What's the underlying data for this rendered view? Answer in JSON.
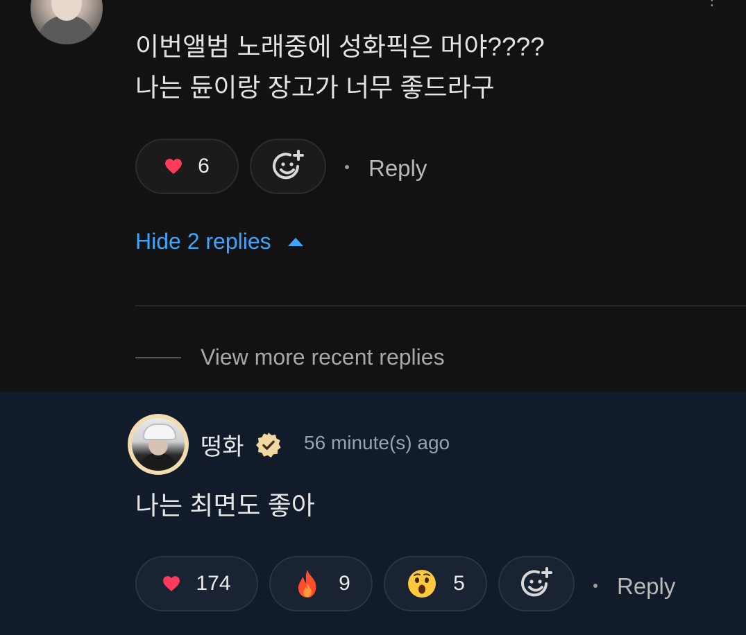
{
  "parent_comment": {
    "text_lines": [
      "이번앨범 노래중에 성화픽은 머야????",
      "나는 듄이랑 장고가 너무 좋드라구"
    ],
    "like_count": "6",
    "reply_label": "Reply",
    "hide_replies_label": "Hide 2 replies",
    "icons": {
      "like": "heart-icon",
      "add_reaction": "add-reaction-icon",
      "collapse": "caret-up-icon",
      "more": "more-options-icon"
    }
  },
  "view_more_label": "View more recent replies",
  "reply": {
    "author": "떵화",
    "timestamp": "56 minute(s) ago",
    "text": "나는 최면도 좋아",
    "reactions": [
      {
        "icon": "heart-icon",
        "count": "174"
      },
      {
        "icon": "fire-icon",
        "count": "9"
      },
      {
        "icon": "surprised-face-icon",
        "count": "5"
      }
    ],
    "reply_label": "Reply",
    "verified_icon": "verified-badge-icon"
  },
  "colors": {
    "background": "#121212",
    "highlight_background": "#111b29",
    "link_blue": "#3ea6ff",
    "heart_red": "#ff3b5c",
    "verified_gold": "#f0d8a0"
  }
}
